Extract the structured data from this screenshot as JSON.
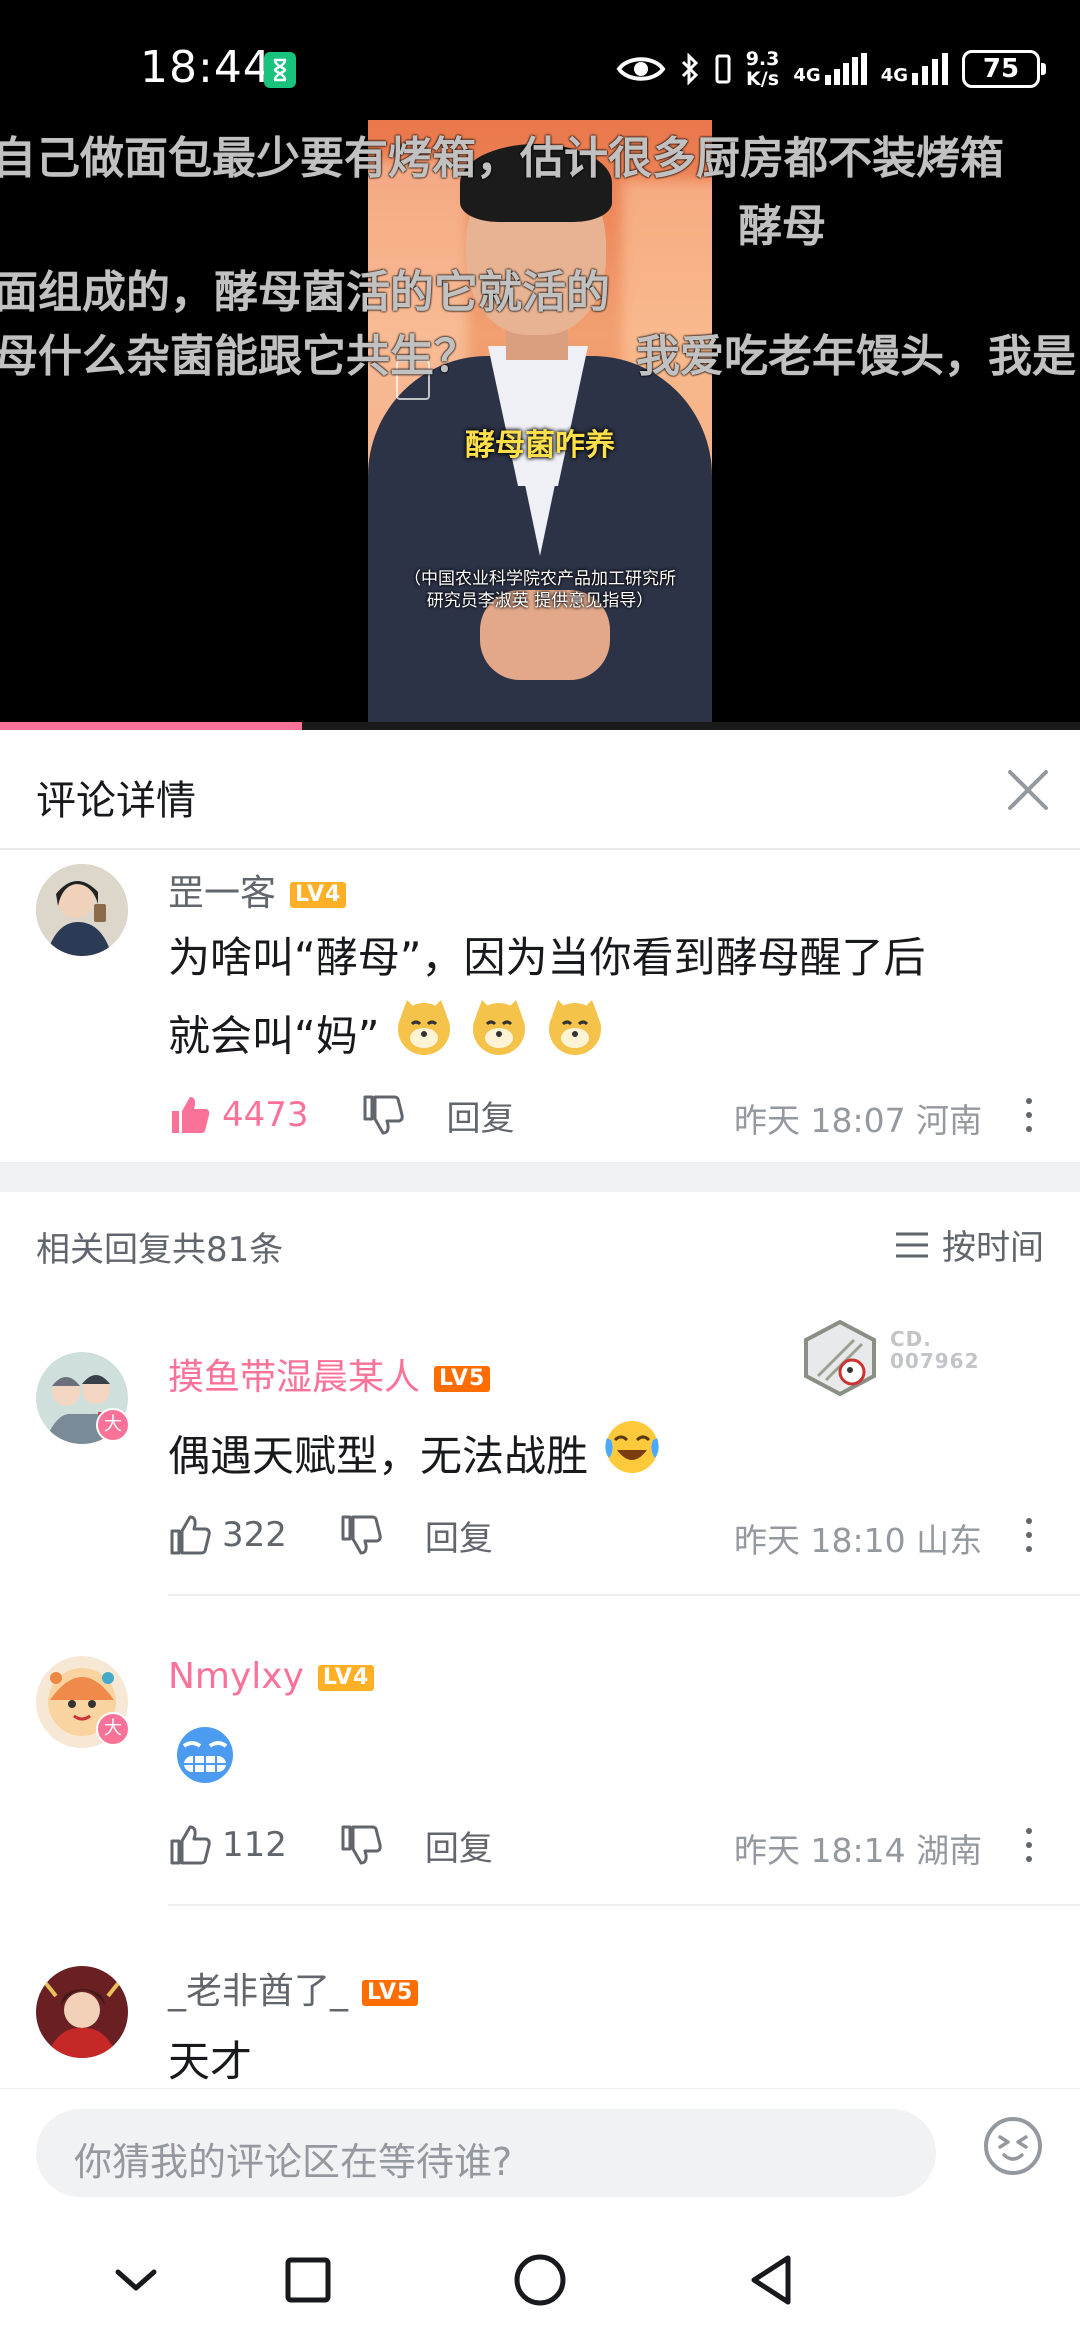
{
  "status_bar": {
    "time": "18:44",
    "net_speed_value": "9.3",
    "net_speed_unit": "K/s",
    "signal1": "4G",
    "signal2": "4G",
    "battery": "75"
  },
  "video": {
    "caption_main": "酵母菌咋养",
    "caption_sub_line1": "（中国农业科学院农产品加工研究所",
    "caption_sub_line2": "研究员李淑英 提供意见指导）",
    "danmaku": [
      "自己做面包最少要有烤箱，估计很多厨房都不装烤箱",
      "酵母",
      "面组成的，酵母菌活的它就活的",
      "母什么杂菌能跟它共生？",
      "我爱吃老年馒头，我是"
    ],
    "progress": 0.28,
    "accent_color": "#fb7299"
  },
  "panel": {
    "title": "评论详情",
    "close_icon": "close-icon"
  },
  "main_comment": {
    "username": "罡一客",
    "level": "LV4",
    "text_line1": "为啥叫“酵母”，因为当你看到酵母醒了后",
    "text_line2": "就会叫“妈”",
    "likes": "4473",
    "reply_label": "回复",
    "time": "昨天 18:07",
    "location": "河南"
  },
  "replies_header": {
    "count_text": "相关回复共81条",
    "sort_label": "按时间"
  },
  "replies": [
    {
      "username": "摸鱼带湿晨某人",
      "level": "LV5",
      "text": "偶遇天赋型，无法战胜",
      "likes": "322",
      "reply_label": "回复",
      "time": "昨天 18:10",
      "location": "山东",
      "badge": "大",
      "fan_badge_line1": "CD.",
      "fan_badge_line2": "007962"
    },
    {
      "username": "Nmylxy",
      "level": "LV4",
      "text": "",
      "likes": "112",
      "reply_label": "回复",
      "time": "昨天 18:14",
      "location": "湖南",
      "badge": "大"
    },
    {
      "username": "_老非酋了_",
      "level": "LV5",
      "text": "天才"
    }
  ],
  "input": {
    "placeholder": "你猜我的评论区在等待谁?"
  }
}
